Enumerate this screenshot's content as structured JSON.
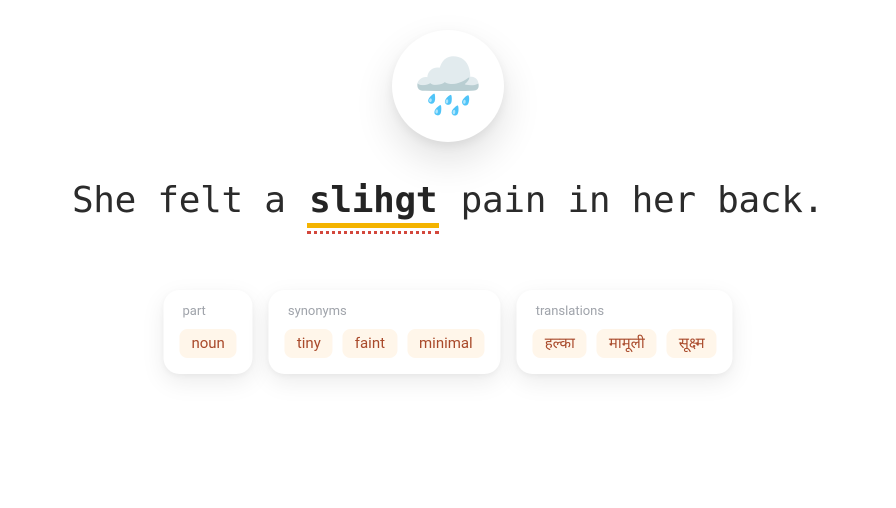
{
  "icon": {
    "emoji": "🌧️",
    "name": "rain-cloud-icon"
  },
  "sentence": {
    "before": "She felt a ",
    "highlight": "slihgt",
    "after": " pain in her back."
  },
  "cards": {
    "part": {
      "label": "part",
      "items": [
        "noun"
      ]
    },
    "synonyms": {
      "label": "synonyms",
      "items": [
        "tiny",
        "faint",
        "minimal"
      ]
    },
    "translations": {
      "label": "translations",
      "items": [
        "हल्का",
        "मामूली",
        "सूक्ष्म"
      ]
    }
  }
}
